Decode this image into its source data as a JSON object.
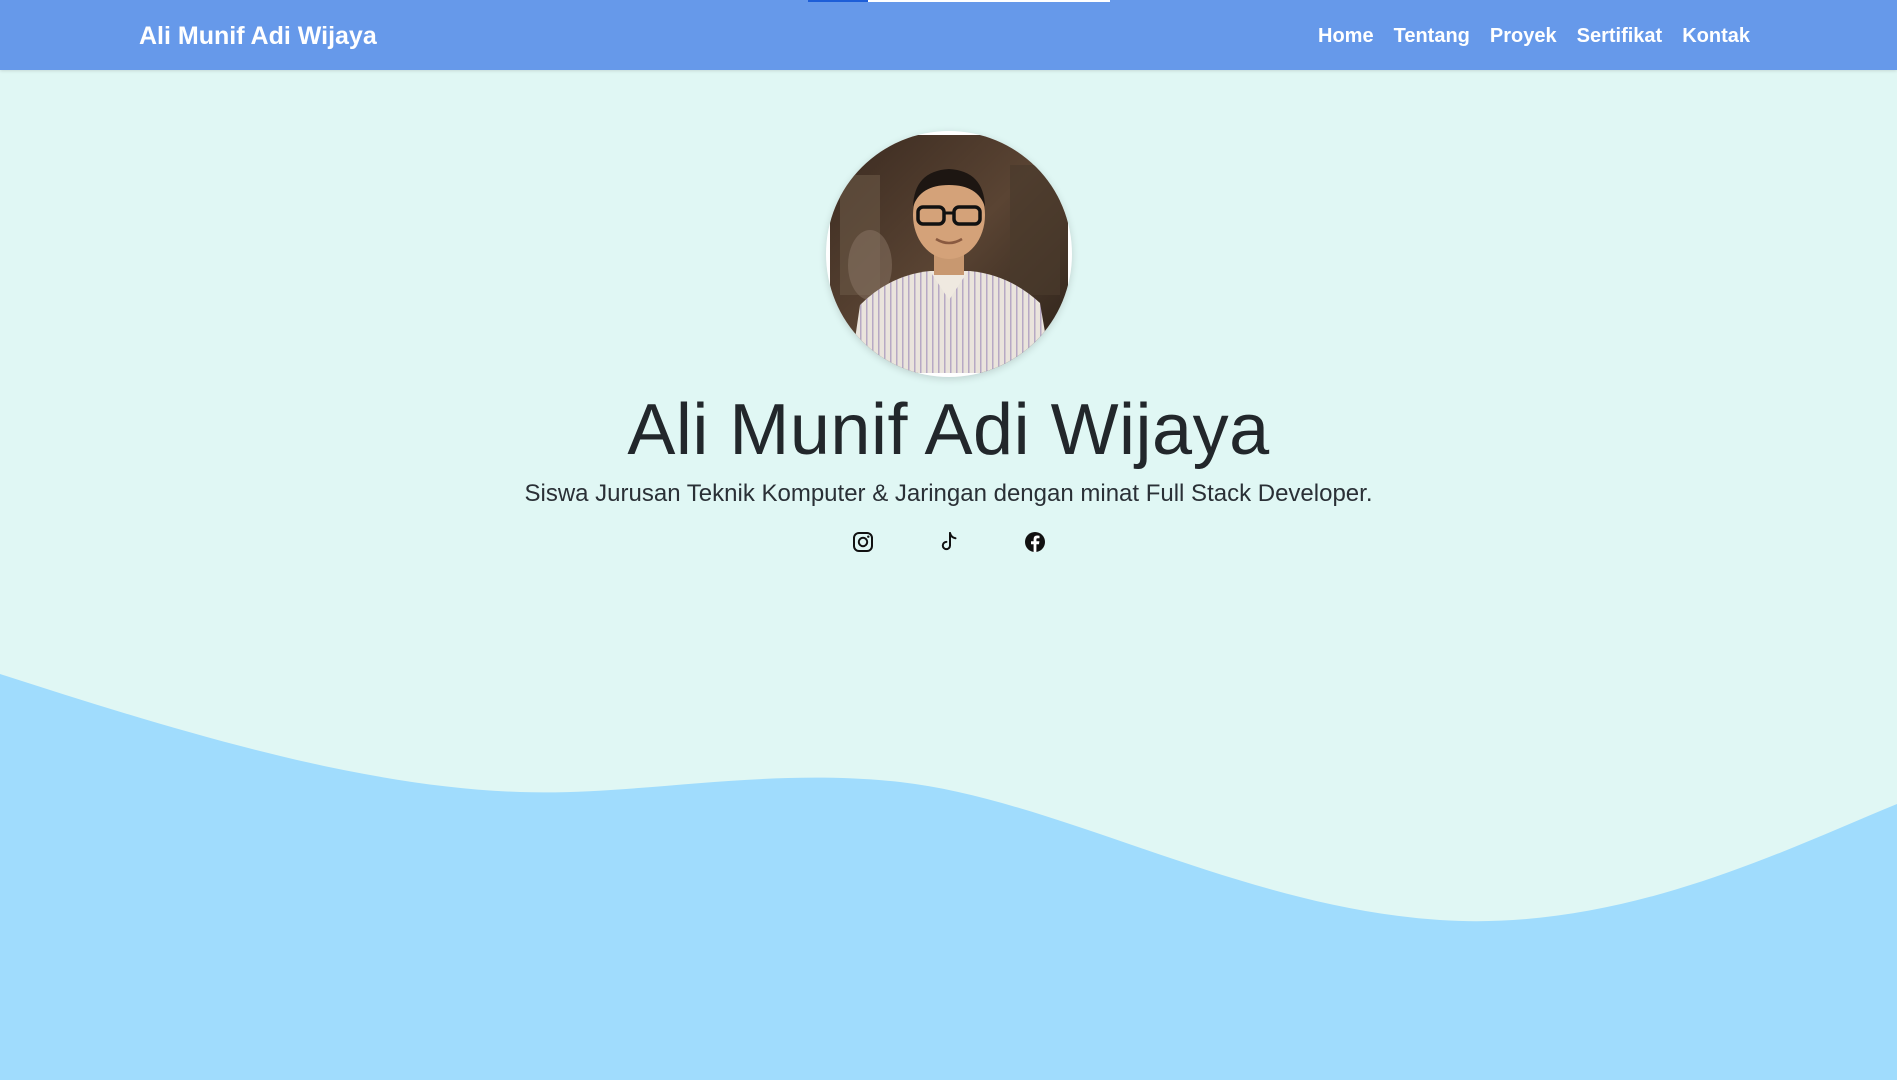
{
  "header": {
    "brand": "Ali Munif Adi Wijaya",
    "nav": [
      {
        "label": "Home"
      },
      {
        "label": "Tentang"
      },
      {
        "label": "Proyek"
      },
      {
        "label": "Sertifikat"
      },
      {
        "label": "Kontak"
      }
    ]
  },
  "hero": {
    "name": "Ali Munif Adi Wijaya",
    "subtitle": "Siswa Jurusan Teknik Komputer & Jaringan dengan minat Full Stack Developer.",
    "social": [
      {
        "icon": "instagram-icon"
      },
      {
        "icon": "tiktok-icon"
      },
      {
        "icon": "facebook-icon"
      }
    ]
  },
  "colors": {
    "navbar": "#6699ea",
    "background": "#e0f7f4",
    "wave": "#a0dcfd",
    "text": "#22272b"
  }
}
